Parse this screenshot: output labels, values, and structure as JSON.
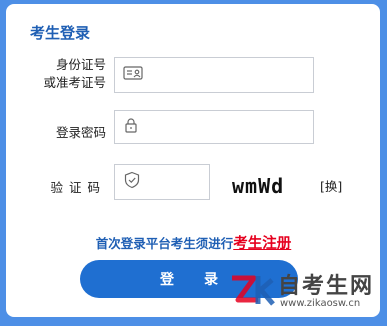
{
  "title": "考生登录",
  "id_field": {
    "label": "身份证号\n或准考证号",
    "value": "",
    "icon": "id-card-icon"
  },
  "password_field": {
    "label": "登录密码",
    "value": "",
    "icon": "lock-icon"
  },
  "captcha_field": {
    "label": "验证码",
    "value": "",
    "icon": "shield-icon"
  },
  "captcha_image": "wmWd",
  "captcha_refresh": "[换]",
  "register": {
    "prefix": "首次登录平台考生须进行",
    "link": "考生注册"
  },
  "login_button": "登录",
  "watermark": {
    "brand": "自考生网",
    "url": "www.zikaosw.cn",
    "logo": "zk-logo"
  },
  "colors": {
    "page_bg": "#4d8fe6",
    "primary": "#1f5fb4",
    "button": "#1f6fd1",
    "link": "#e6001e"
  }
}
